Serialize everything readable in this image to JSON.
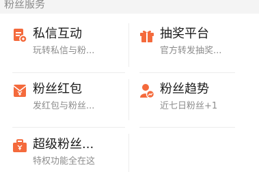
{
  "section": {
    "title": "粉丝服务"
  },
  "items": [
    {
      "title": "私信互动",
      "subtitle": "玩转私信与粉...",
      "icon": "message-doc-icon"
    },
    {
      "title": "抽奖平台",
      "subtitle": "官方转发抽奖...",
      "icon": "gift-icon"
    },
    {
      "title": "粉丝红包",
      "subtitle": "发红包与粉丝...",
      "icon": "red-envelope-icon"
    },
    {
      "title": "粉丝趋势",
      "subtitle": "近七日粉丝+1",
      "icon": "user-trend-icon"
    },
    {
      "title": "超级粉丝...",
      "subtitle": "特权功能全在这",
      "icon": "wallet-icon"
    }
  ],
  "colors": {
    "accent": "#f46a3c",
    "text": "#1a1a1a",
    "subtext": "#8c8c8c",
    "divider": "#ececec"
  }
}
